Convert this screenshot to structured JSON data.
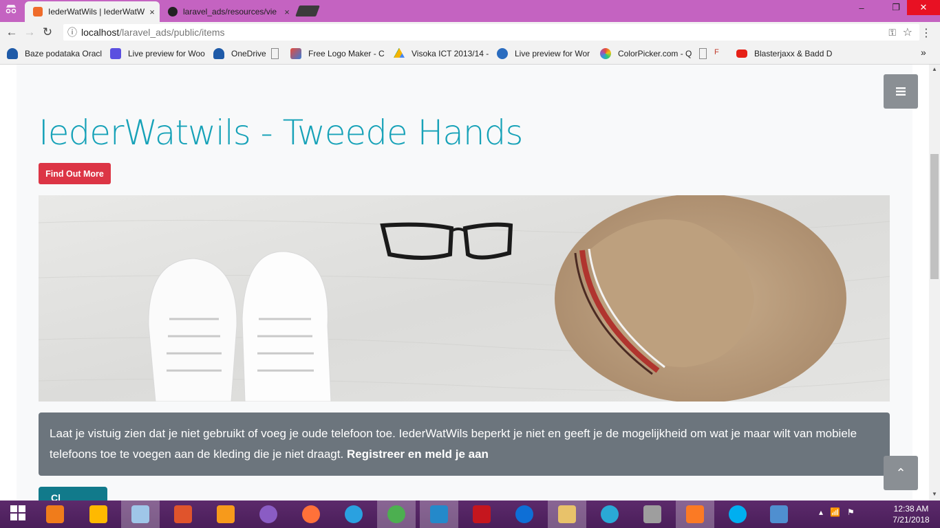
{
  "browser": {
    "tabs": [
      {
        "title": "IederWatWils | IederWatW",
        "close": "×",
        "favicon_color": "#ef6c2b"
      },
      {
        "title": "laravel_ads/resources/vie",
        "close": "×",
        "favicon_color": "#222222"
      }
    ],
    "window_controls": {
      "minimize": "–",
      "maximize": "❐",
      "close": "✕"
    },
    "nav": {
      "back": "←",
      "forward": "→",
      "reload": "↻"
    },
    "url": {
      "host": "localhost",
      "path": "/laravel_ads/public/items"
    },
    "omnibox_icons": {
      "info": "ⓘ",
      "key": "⚿",
      "star": "☆"
    },
    "menu": "⋮",
    "bookmarks": [
      {
        "label": "Baze podataka Oracl",
        "icon": "cloud-icon",
        "color": "#1e5aa8"
      },
      {
        "label": "Live preview for Woo",
        "icon": "preview-icon",
        "color": "#5b4fe0"
      },
      {
        "label": "OneDrive",
        "icon": "onedrive-icon",
        "color": "#1e5aa8"
      },
      {
        "label": "",
        "icon": "page-icon",
        "color": "#888888"
      },
      {
        "label": "Free Logo Maker - C",
        "icon": "logo-maker-icon",
        "color": "#3a7bd5"
      },
      {
        "label": "Visoka ICT 2013/14 -",
        "icon": "drive-icon",
        "color": "#f4b400"
      },
      {
        "label": "Live preview for Wor",
        "icon": "wp-icon",
        "color": "#2a6cbf"
      },
      {
        "label": "ColorPicker.com - Q",
        "icon": "palette-icon",
        "color": "#c0392b"
      },
      {
        "label": "",
        "icon": "page-icon",
        "color": "#888888"
      },
      {
        "label": "",
        "icon": "f-icon",
        "color": "#c0392b"
      },
      {
        "label": "Blasterjaxx & Badd D",
        "icon": "youtube-icon",
        "color": "#e62117"
      }
    ],
    "bookmarks_overflow": "»"
  },
  "page": {
    "heading": "IederWatwils - Tweede Hands",
    "find_button": "Find Out More",
    "alert_text": "Laat je vistuig zien dat je niet gebruikt of voeg je oude telefoon toe. IederWatWils beperkt je niet en geeft je de mogelijkheid om wat je maar wilt van mobiele telefoons toe te voegen aan de kleding die je niet draagt.",
    "alert_link": "Registreer en meld je aan",
    "next_button": "Cl",
    "toggler": "≡",
    "scroll_top": "⌃",
    "colors": {
      "accent": "#17a2b8",
      "danger": "#dc3545",
      "secondary": "#6c757d"
    }
  },
  "taskbar": {
    "items": [
      {
        "icon": "windows-start-icon",
        "color": "#ffffff",
        "active": false
      },
      {
        "icon": "avast-icon",
        "color": "#f07c1b",
        "active": false
      },
      {
        "icon": "file-explorer-icon",
        "color": "#ffb900",
        "active": false
      },
      {
        "icon": "virtualbox-icon",
        "color": "#9fc6e8",
        "active": true
      },
      {
        "icon": "brackets-icon",
        "color": "#e0542c",
        "active": false
      },
      {
        "icon": "sublime-icon",
        "color": "#f79a1b",
        "active": false
      },
      {
        "icon": "github-desktop-icon",
        "color": "#8a5cc4",
        "active": false
      },
      {
        "icon": "firefox-icon",
        "color": "#ff7139",
        "active": false
      },
      {
        "icon": "ie-icon",
        "color": "#2aa1e0",
        "active": false
      },
      {
        "icon": "chrome-icon",
        "color": "#4caf50",
        "active": true
      },
      {
        "icon": "vscode-icon",
        "color": "#2489ca",
        "active": true
      },
      {
        "icon": "filezilla-icon",
        "color": "#c5161e",
        "active": false
      },
      {
        "icon": "teamviewer-icon",
        "color": "#0e6fd6",
        "active": false
      },
      {
        "icon": "folder-icon",
        "color": "#e8c26a",
        "active": true
      },
      {
        "icon": "settings-app-icon",
        "color": "#2aa9d6",
        "active": false
      },
      {
        "icon": "owl-icon",
        "color": "#9e9e9e",
        "active": false
      },
      {
        "icon": "xampp-icon",
        "color": "#fb7a24",
        "active": true
      },
      {
        "icon": "skype-icon",
        "color": "#00aff0",
        "active": false
      },
      {
        "icon": "photos-icon",
        "color": "#4f8fd0",
        "active": false
      }
    ],
    "tray": {
      "chevron": "▴",
      "network": "📶",
      "flag": "⚑"
    },
    "time": "12:38 AM",
    "date": "7/21/2018"
  }
}
